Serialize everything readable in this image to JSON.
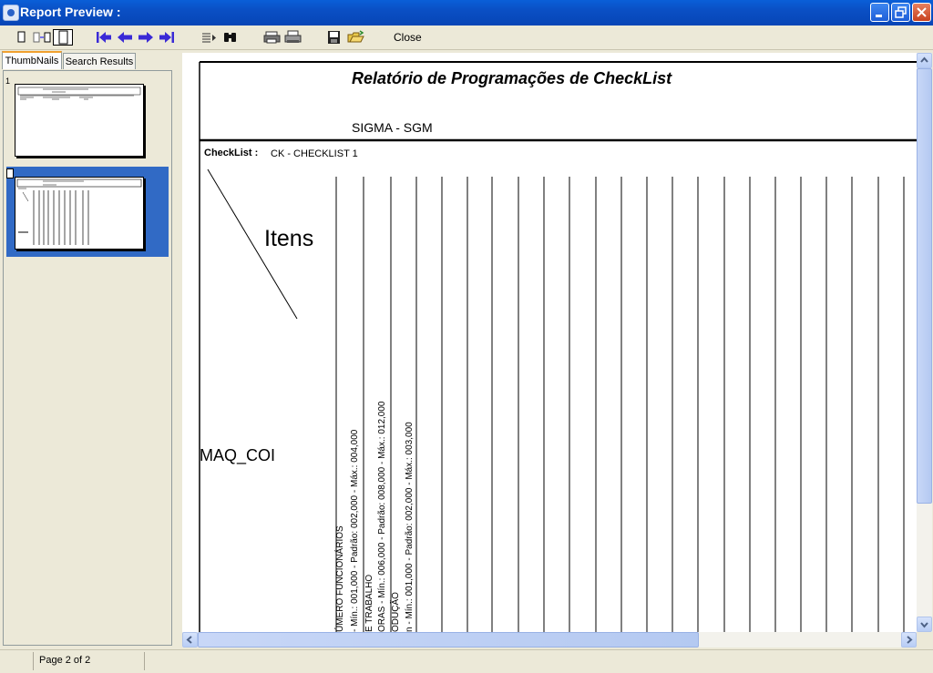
{
  "window": {
    "title": "Report Preview :"
  },
  "toolbar": {
    "close_label": "Close"
  },
  "tabs": [
    {
      "label": "ThumbNails"
    },
    {
      "label": "Search Results"
    }
  ],
  "thumbnails": [
    {
      "number": "1"
    },
    {
      "number": ""
    }
  ],
  "report": {
    "title": "Relatório de Programações de CheckList",
    "subtitle": "SIGMA - SGM",
    "checklist_label": "CheckList :",
    "checklist_value": "CK - CHECKLIST 1",
    "items_header": "Itens",
    "machine_label": "MAQ_COI",
    "columns": [
      {
        "line1": "ÚMERO FUNCIONÁRIOS",
        "line2": "- Mín.: 001,000 - Padrão: 002,000 - Máx.: 004,000"
      },
      {
        "line1": "E TRABALHO",
        "line2": "ORAS - Mín.: 006,000 - Padrão: 008,000 - Máx.: 012,000"
      },
      {
        "line1": "ODUÇÃO",
        "line2": "n - Mín.: 001,000 - Padrão: 002,000 - Máx.: 003,000"
      }
    ]
  },
  "statusbar": {
    "page_info": "Page 2 of 2"
  },
  "colors": {
    "titlebar": "#0a5fd8",
    "selection": "#316ac5",
    "arrows": "#3a2ad6"
  },
  "icons": [
    "single-page-icon",
    "two-page-icon",
    "whole-page-icon",
    "first-page-icon",
    "prev-page-icon",
    "next-page-icon",
    "last-page-icon",
    "goto-page-icon",
    "find-icon",
    "print-setup-icon",
    "print-icon",
    "save-icon",
    "open-icon"
  ]
}
